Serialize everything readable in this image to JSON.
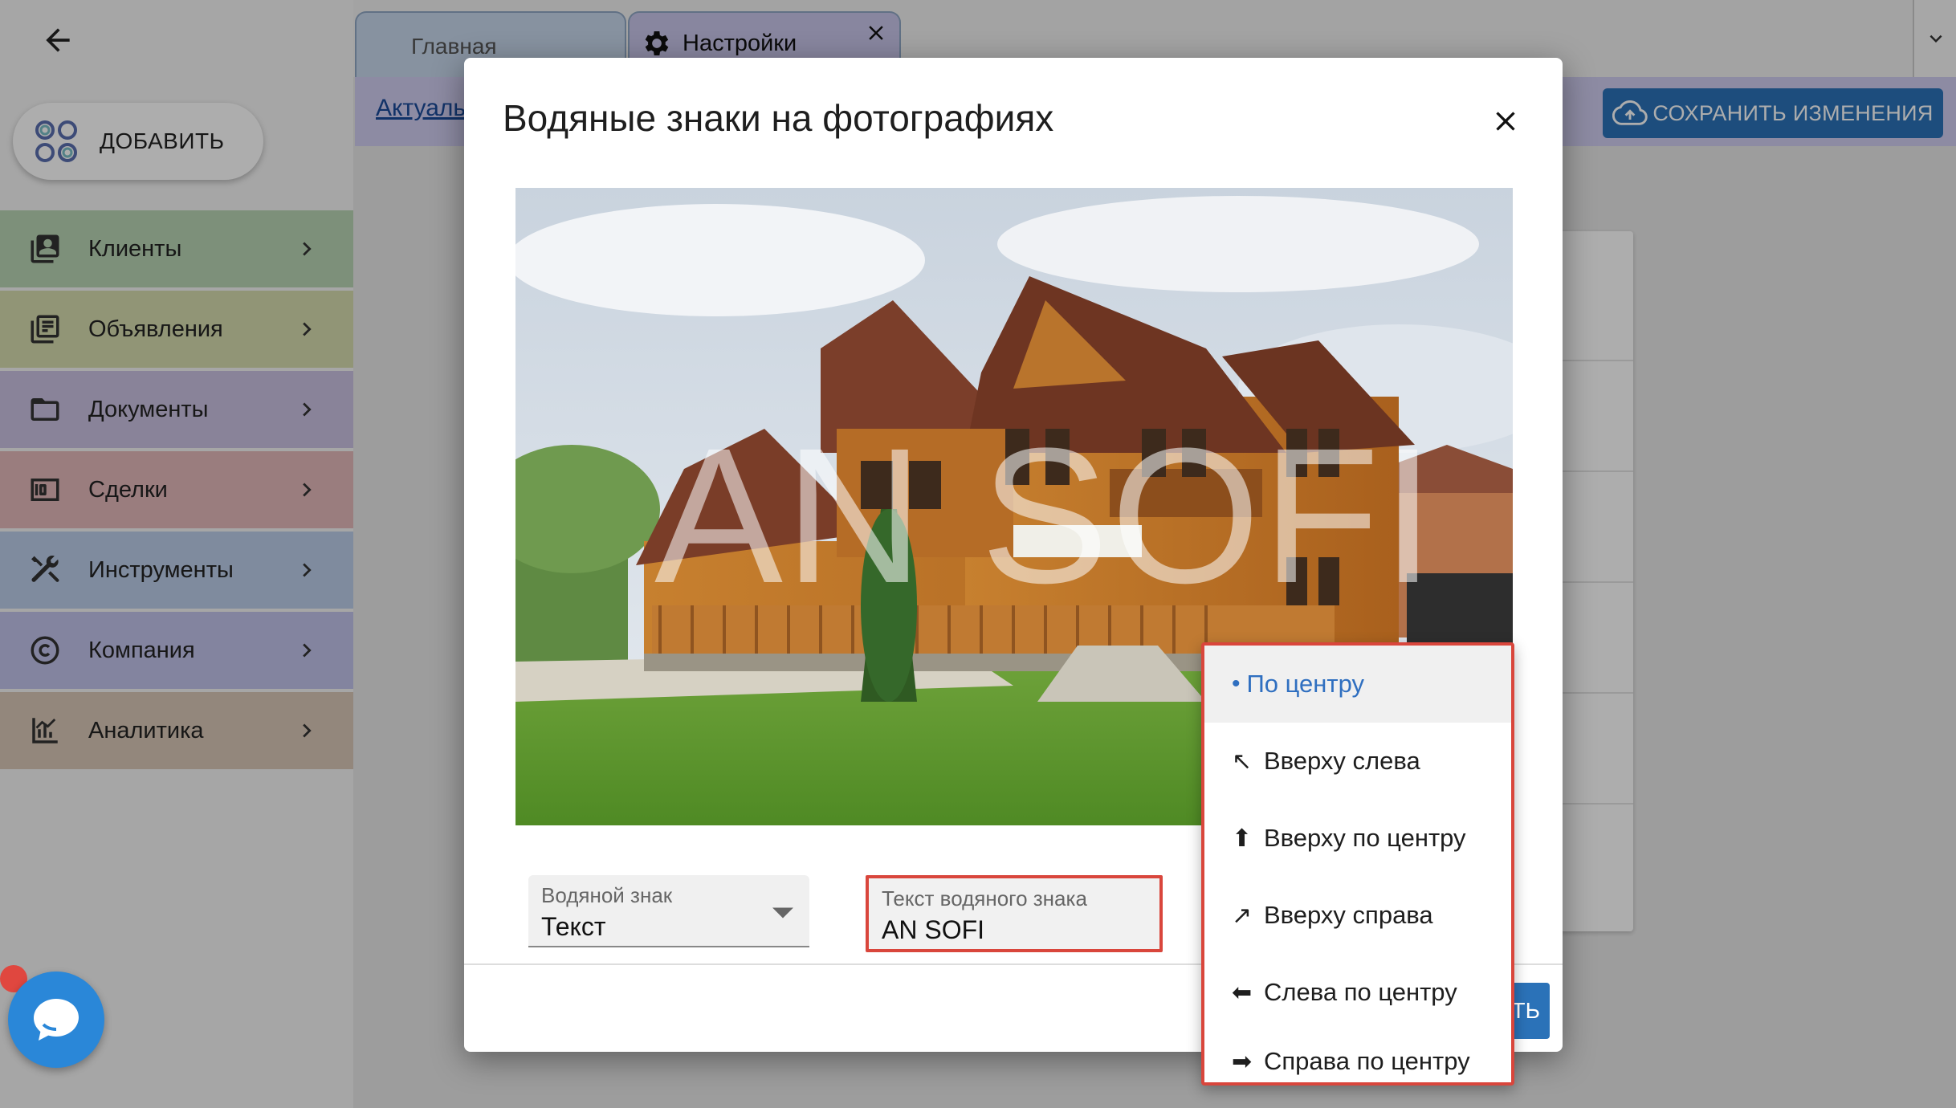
{
  "app": {
    "add_label": "ДОБАВИТЬ",
    "tabs": [
      {
        "label": "Главная"
      },
      {
        "label": "Настройки"
      }
    ],
    "sub_link": "Актуаль",
    "save_label": "СОХРАНИТЬ ИЗМЕНЕНИЯ"
  },
  "sidebar": {
    "items": [
      {
        "label": "Клиенты",
        "color": "#b9d5b4"
      },
      {
        "label": "Объявления",
        "color": "#d6dcaf"
      },
      {
        "label": "Документы",
        "color": "#cbc2e2"
      },
      {
        "label": "Сделки",
        "color": "#e4b8ba"
      },
      {
        "label": "Инструменты",
        "color": "#bccde9"
      },
      {
        "label": "Компания",
        "color": "#c2c3ea"
      },
      {
        "label": "Аналитика",
        "color": "#d9c8b7"
      }
    ]
  },
  "modal": {
    "title": "Водяные знаки на фотографиях",
    "watermark_overlay": "AN SOFI",
    "watermark_type": {
      "label": "Водяной знак",
      "value": "Текст"
    },
    "watermark_text": {
      "label": "Текст водяного знака",
      "value": "AN SOFI"
    },
    "apply_partial": "ТЬ"
  },
  "dropdown": {
    "items": [
      {
        "label": "По центру",
        "arrow": "•",
        "selected": true
      },
      {
        "label": "Вверху слева",
        "arrow": "↖"
      },
      {
        "label": "Вверху по центру",
        "arrow": "⬆"
      },
      {
        "label": "Вверху справа",
        "arrow": "↗"
      },
      {
        "label": "Слева по центру",
        "arrow": "⬅"
      },
      {
        "label": "Справа по центру",
        "arrow": "➡"
      }
    ]
  },
  "colors": {
    "accent": "#2b72b8",
    "highlight": "#d9463c",
    "selected_text": "#2f6fc0"
  }
}
